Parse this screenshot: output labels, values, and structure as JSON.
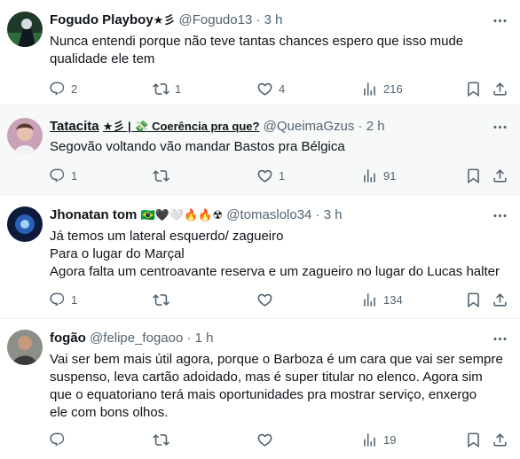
{
  "tweets": [
    {
      "name": "Fogudo Playboy",
      "name_emoji": "★彡",
      "handle": "@Fogudo13",
      "time": "3 h",
      "lines": [
        "Nunca entendi porque não teve tantas chances espero que isso mude",
        "qualidade ele tem"
      ],
      "replies": "2",
      "retweets": "1",
      "likes": "4",
      "views": "216"
    },
    {
      "name": "Tatacita",
      "name_emoji": "★彡 | 💸 Coerência pra que?",
      "handle": "@QueimaGzus",
      "time": "2 h",
      "lines": [
        "Segovão voltando vão mandar Bastos pra Bélgica"
      ],
      "replies": "1",
      "retweets": "",
      "likes": "1",
      "views": "91"
    },
    {
      "name": "Jhonatan tom",
      "name_emoji": "🇧🇷🖤🤍🔥🔥☢",
      "handle": "@tomaslolo34",
      "time": "3 h",
      "lines": [
        "Já temos um lateral esquerdo/ zagueiro",
        "Para o lugar do Marçal",
        "Agora falta um centroavante reserva e um zagueiro no lugar do Lucas halter"
      ],
      "replies": "1",
      "retweets": "",
      "likes": "",
      "views": "134"
    },
    {
      "name": "fogão",
      "name_emoji": "",
      "handle": "@felipe_fogaoo",
      "time": "1 h",
      "lines": [
        "Vai ser bem mais útil agora, porque o Barboza é um cara que vai ser sempre",
        "suspenso, leva cartão adoidado, mas é super titular no elenco. Agora sim",
        "que o equatoriano terá mais oportunidades pra mostrar serviço, enxergo",
        "ele com bons olhos."
      ],
      "replies": "",
      "retweets": "",
      "likes": "",
      "views": "19"
    }
  ],
  "separator": "·",
  "colors": {
    "text": "#0f1419",
    "secondary": "#536471",
    "highlight_bg": "#f7f9f9",
    "border": "#eff3f4"
  },
  "icons": [
    "reply-icon",
    "retweet-icon",
    "like-icon",
    "views-icon",
    "bookmark-icon",
    "share-icon",
    "more-icon",
    "avatar"
  ]
}
